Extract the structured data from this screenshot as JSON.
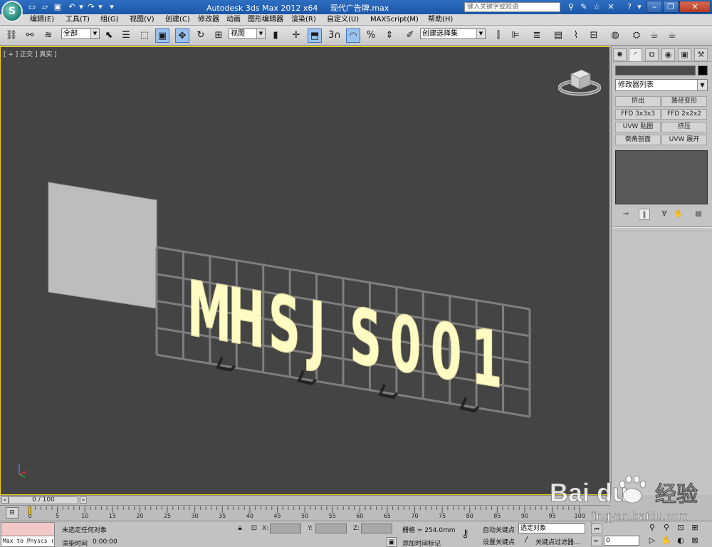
{
  "titlebar": {
    "app_title": "Autodesk 3ds Max  2012 x64",
    "file_name": "现代广告牌.max",
    "search_placeholder": "键入关键字或短语"
  },
  "menu": [
    "编辑(E)",
    "工具(T)",
    "组(G)",
    "视图(V)",
    "创建(C)",
    "修改器",
    "动画",
    "图形编辑器",
    "渲染(R)",
    "自定义(U)",
    "MAXScript(M)",
    "帮助(H)"
  ],
  "toolbar": {
    "selection_filter": "全部",
    "ref_coord": "视图",
    "named_selection": "创建选择集",
    "snap_label": "3"
  },
  "viewport": {
    "label": "[ + ] 正交 ] 真实 ]",
    "sign_text": "MHSJS001",
    "colors": {
      "background": "#444444",
      "letters": "#fffdc4",
      "grid": "#7e7e7e",
      "board": "#bdbdbd"
    }
  },
  "command_panel": {
    "modifier_list": "修改器列表",
    "modifier_buttons": [
      "挤出",
      "路径变形",
      "FFD 3x3x3",
      "FFD 2x2x2",
      "UVW 贴图",
      "挤压",
      "倒角剖面",
      "UVW 展开"
    ]
  },
  "timeslider": {
    "frame_display": "0 / 100"
  },
  "trackbar": {
    "ticks": [
      "0",
      "5",
      "10",
      "15",
      "20",
      "25",
      "30",
      "35",
      "40",
      "45",
      "50",
      "55",
      "60",
      "65",
      "70",
      "75",
      "80",
      "85",
      "90",
      "95",
      "100"
    ]
  },
  "status": {
    "maxscript": "Max to Physcs (",
    "selection_status": "未选定任何对象",
    "render_time_label": "渲染时间",
    "render_time": "0:00:00",
    "x_label": "X:",
    "y_label": "Y:",
    "z_label": "Z:",
    "grid": "栅格 = 254.0mm",
    "add_time_tag": "添加时间标记",
    "auto_key": "自动关键点",
    "set_key": "设置关键点",
    "key_mode": "选定对象",
    "key_filters": "关键点过滤器...",
    "frame": "0"
  },
  "watermark": {
    "brand": "Bai du",
    "jingyan": "经验",
    "url": "jingyan.baidu.com"
  }
}
